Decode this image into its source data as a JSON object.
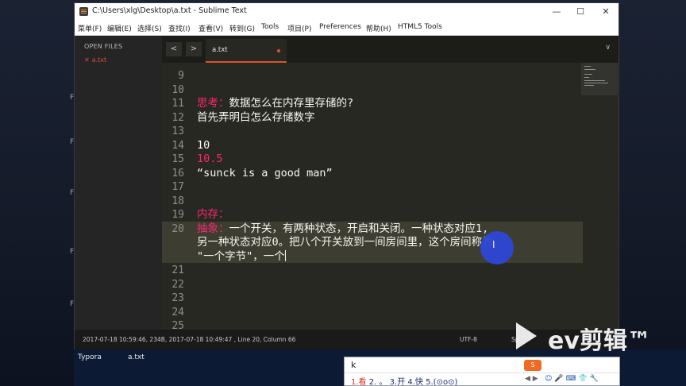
{
  "window": {
    "title": "C:\\Users\\xlg\\Desktop\\a.txt - Sublime Text",
    "minimize": "—",
    "maximize": "☐",
    "close": "✕"
  },
  "menu": [
    "菜单(F)",
    "编辑(E)",
    "选择(S)",
    "查找(I)",
    "查看(V)",
    "转到(G)",
    "Tools",
    "项目(P)",
    "Preferences",
    "帮助(H)",
    "HTML5 Tools"
  ],
  "sidebar": {
    "header": "OPEN FILES",
    "file": "a.txt",
    "close_glyph": "✕"
  },
  "tabs": {
    "active": "a.txt",
    "prev": "<",
    "next": ">",
    "dropdown": "∨"
  },
  "lines": [
    {
      "num": "9",
      "parts": []
    },
    {
      "num": "10",
      "parts": []
    },
    {
      "num": "11",
      "parts": [
        {
          "text": "思考：",
          "color": "pink"
        },
        {
          "text": "数据怎么在内存里存储的?",
          "color": "white"
        }
      ]
    },
    {
      "num": "12",
      "parts": [
        {
          "text": "首先弄明白怎么存储数字",
          "color": "white"
        }
      ]
    },
    {
      "num": "13",
      "parts": []
    },
    {
      "num": "14",
      "parts": [
        {
          "text": "10",
          "color": "white"
        }
      ]
    },
    {
      "num": "15",
      "parts": [
        {
          "text": "10.5",
          "color": "pink"
        }
      ]
    },
    {
      "num": "16",
      "parts": [
        {
          "text": "“sunck is a good man”",
          "color": "white"
        }
      ]
    },
    {
      "num": "17",
      "parts": []
    },
    {
      "num": "18",
      "parts": []
    },
    {
      "num": "19",
      "parts": [
        {
          "text": "内存：",
          "color": "pink"
        }
      ]
    },
    {
      "num": "20",
      "parts": [
        {
          "text": "抽象：",
          "color": "pink"
        },
        {
          "text": "一个开关，有两种状态，开启和关闭。一种状态对应1,",
          "color": "white"
        }
      ]
    },
    {
      "num": "",
      "parts": [
        {
          "text": "另一种状态对应0。把八个开关放到一间房间里，这个房间称为",
          "color": "white"
        }
      ]
    },
    {
      "num": "",
      "parts": [
        {
          "text": "\"一个字节\"，一个",
          "color": "white"
        }
      ]
    },
    {
      "num": "21",
      "parts": []
    },
    {
      "num": "22",
      "parts": []
    },
    {
      "num": "23",
      "parts": []
    },
    {
      "num": "24",
      "parts": []
    },
    {
      "num": "25",
      "parts": []
    }
  ],
  "status": {
    "text": "2017-07-18 10:59:46, 234B, 2017-07-18 10:49:47 , Line 20, Column 66",
    "encoding": "UTF-8",
    "spaces": "Sp"
  },
  "taskbar": {
    "app": "Typora",
    "file": "a.txt"
  },
  "ime": {
    "input": "k",
    "candidates": [
      "1.看",
      "2. 。",
      "3.开",
      "4.快",
      "5.(⊙o⊙)"
    ],
    "arrows": "◀ ▶",
    "logo": "S",
    "tools": "☺🎤⌨👕🔧"
  },
  "watermark": {
    "text": "ev剪辑™"
  },
  "colors": {
    "pink": "#f92672",
    "white": "#f8f8f2",
    "accent": "#d9532f"
  }
}
